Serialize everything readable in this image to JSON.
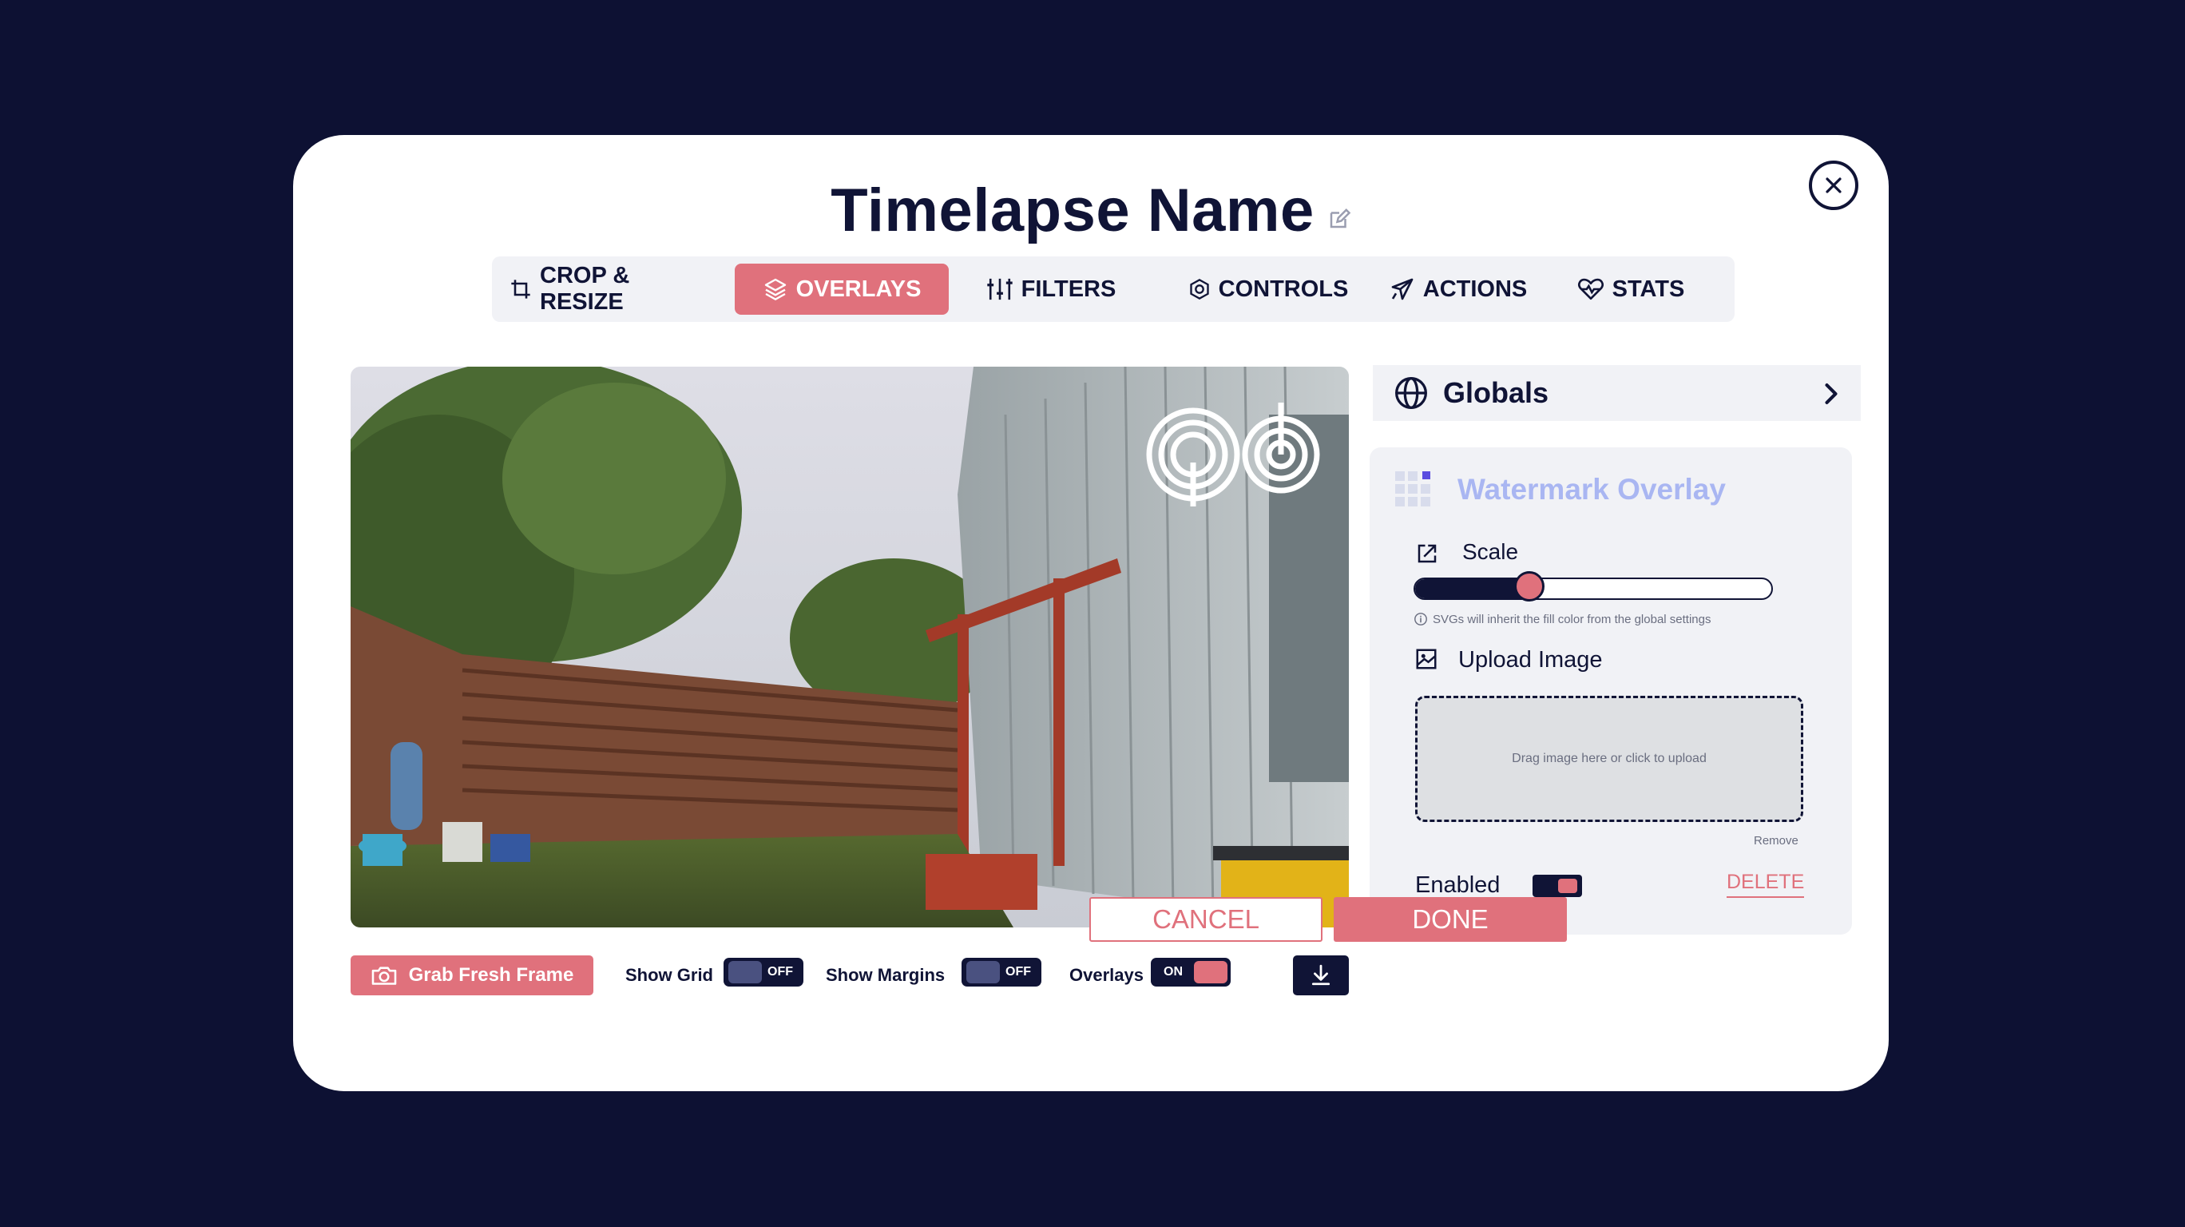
{
  "modal": {
    "title": "Timelapse Name"
  },
  "tabs": [
    {
      "label": "CROP & RESIZE",
      "icon": "crop-icon"
    },
    {
      "label": "OVERLAYS",
      "icon": "layers-icon",
      "active": true
    },
    {
      "label": "FILTERS",
      "icon": "sliders-icon"
    },
    {
      "label": "CONTROLS",
      "icon": "hexagon-icon"
    },
    {
      "label": "ACTIONS",
      "icon": "plane-icon"
    },
    {
      "label": "STATS",
      "icon": "heart-pulse-icon"
    }
  ],
  "toolbar": {
    "grab_label": "Grab Fresh Frame",
    "show_grid_label": "Show Grid",
    "show_grid_state": "OFF",
    "show_margins_label": "Show Margins",
    "show_margins_state": "OFF",
    "overlays_label": "Overlays",
    "overlays_state": "ON"
  },
  "globals": {
    "label": "Globals"
  },
  "watermark": {
    "title": "Watermark Overlay",
    "scale_label": "Scale",
    "scale_value": 0.32,
    "hint": "SVGs will inherit the fill color from the global settings",
    "upload_label": "Upload Image",
    "dropzone_text": "Drag image here or click to upload",
    "remove_label": "Remove",
    "enabled_label": "Enabled",
    "enabled": true,
    "delete_label": "DELETE"
  },
  "footer": {
    "cancel_label": "CANCEL",
    "done_label": "DONE"
  },
  "colors": {
    "background": "#0d1133",
    "accent": "#e0717c",
    "dark": "#101436",
    "panel": "#f1f2f6",
    "watermark_title": "#a9b6f2"
  }
}
